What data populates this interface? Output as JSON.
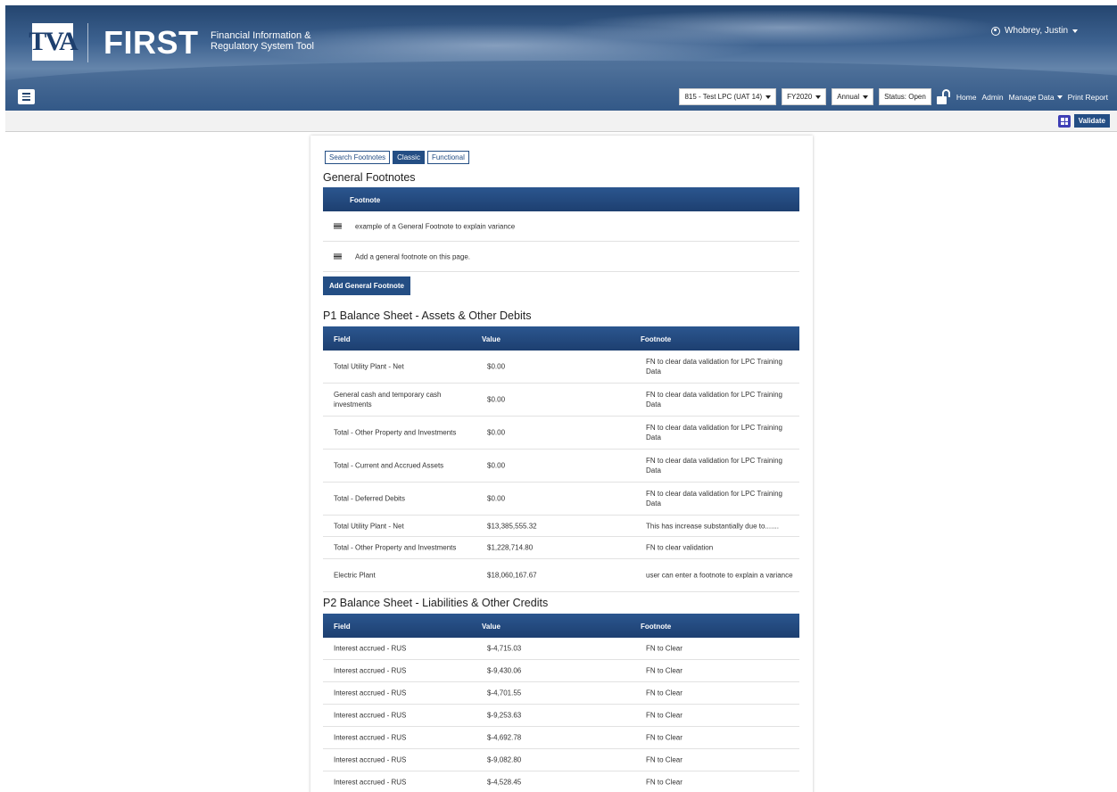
{
  "header": {
    "logo_text": "TVA",
    "app_name": "FIRST",
    "app_subtitle": "Financial Information & Regulatory System Tool",
    "user_name": "Whobrey, Justin"
  },
  "nav": {
    "org_select": "815 - Test LPC (UAT 14)",
    "year_select": "FY2020",
    "period_select": "Annual",
    "status": "Status: Open",
    "links": {
      "home": "Home",
      "admin": "Admin",
      "manage_data": "Manage Data",
      "print_report": "Print Report"
    }
  },
  "subbar": {
    "validate_label": "Validate"
  },
  "tabs": [
    {
      "label": "Search Footnotes",
      "active": false
    },
    {
      "label": "Classic",
      "active": true
    },
    {
      "label": "Functional",
      "active": false
    }
  ],
  "general": {
    "title": "General Footnotes",
    "header": "Footnote",
    "rows": [
      "example of a General Footnote to explain variance",
      "Add a general footnote on this page."
    ],
    "add_button": "Add General Footnote"
  },
  "p1": {
    "title": "P1 Balance Sheet - Assets & Other Debits",
    "headers": {
      "field": "Field",
      "value": "Value",
      "footnote": "Footnote"
    },
    "rows": [
      {
        "field": "Total Utility Plant - Net",
        "value": "$0.00",
        "footnote": "FN to clear data validation for LPC Training Data"
      },
      {
        "field": "General cash and temporary cash investments",
        "value": "$0.00",
        "footnote": "FN to clear data validation for LPC Training Data"
      },
      {
        "field": "Total - Other Property and Investments",
        "value": "$0.00",
        "footnote": "FN to clear data validation for LPC Training Data"
      },
      {
        "field": "Total - Current and Accrued Assets",
        "value": "$0.00",
        "footnote": "FN to clear data validation for LPC Training Data"
      },
      {
        "field": "Total - Deferred Debits",
        "value": "$0.00",
        "footnote": "FN to clear data validation for LPC Training Data"
      },
      {
        "field": "Total Utility Plant - Net",
        "value": "$13,385,555.32",
        "footnote": "This has increase substantially due to......."
      },
      {
        "field": "Total - Other Property and Investments",
        "value": "$1,228,714.80",
        "footnote": "FN to clear validation"
      },
      {
        "field": "Electric Plant",
        "value": "$18,060,167.67",
        "footnote": "user can enter a footnote to explain a variance"
      }
    ]
  },
  "p2": {
    "title": "P2 Balance Sheet - Liabilities & Other Credits",
    "headers": {
      "field": "Field",
      "value": "Value",
      "footnote": "Footnote"
    },
    "rows": [
      {
        "field": "Interest accrued - RUS",
        "value": "$-4,715.03",
        "footnote": "FN to Clear"
      },
      {
        "field": "Interest accrued - RUS",
        "value": "$-9,430.06",
        "footnote": "FN to Clear"
      },
      {
        "field": "Interest accrued - RUS",
        "value": "$-4,701.55",
        "footnote": "FN to Clear"
      },
      {
        "field": "Interest accrued - RUS",
        "value": "$-9,253.63",
        "footnote": "FN to Clear"
      },
      {
        "field": "Interest accrued - RUS",
        "value": "$-4,692.78",
        "footnote": "FN to Clear"
      },
      {
        "field": "Interest accrued - RUS",
        "value": "$-9,082.80",
        "footnote": "FN to Clear"
      },
      {
        "field": "Interest accrued - RUS",
        "value": "$-4,528.45",
        "footnote": "FN to Clear"
      }
    ]
  }
}
